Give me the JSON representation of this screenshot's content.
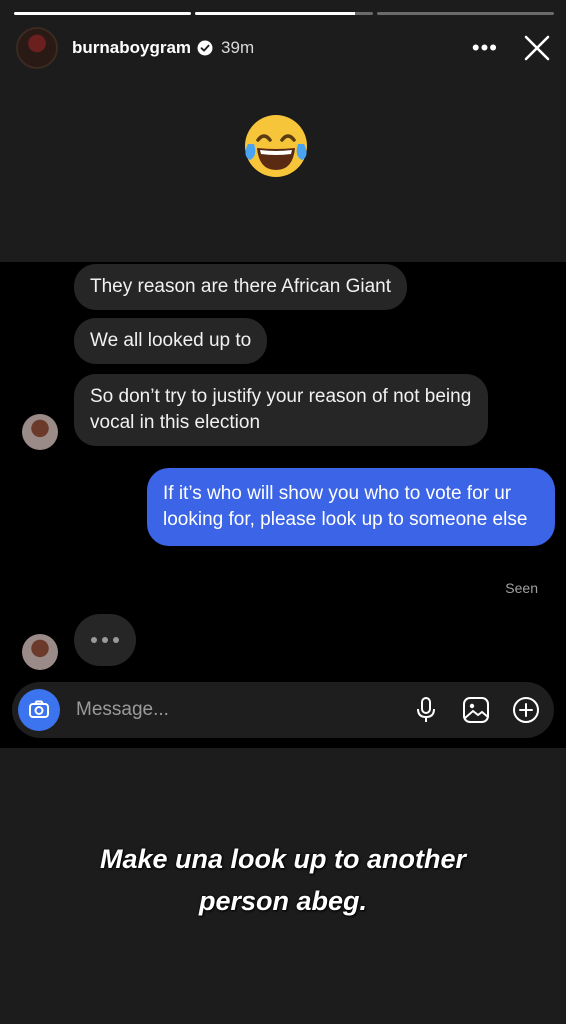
{
  "story": {
    "progress": [
      1.0,
      0.9,
      0.0
    ],
    "username": "burnaboygram",
    "time_ago": "39m",
    "more_label": "•••"
  },
  "chat": {
    "incoming": [
      "They reason are there African Giant",
      "We all looked up to",
      "So don’t try to justify your reason of not being vocal in this election"
    ],
    "outgoing": "If it’s who will show you who to vote for ur looking for, please look up to someone else",
    "seen_label": "Seen"
  },
  "composer": {
    "placeholder": "Message..."
  },
  "caption": {
    "line1": "Make una look up to another",
    "line2": "person abeg."
  },
  "colors": {
    "outgoing_bubble": "#3b64e6",
    "incoming_bubble": "#262626",
    "camera_button": "#3b74ee"
  }
}
